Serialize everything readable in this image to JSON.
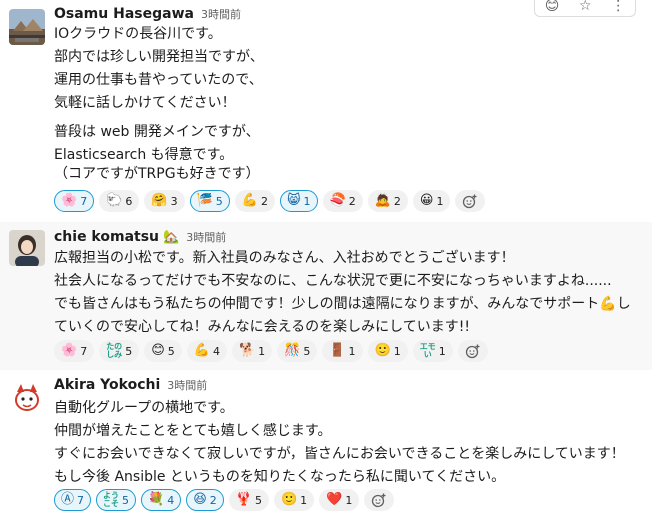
{
  "messages": [
    {
      "name": "Osamu Hasegawa",
      "status_emoji": "",
      "time": "3時間前",
      "lines": [
        "IOクラウドの長谷川です。",
        "部内では珍しい開発担当ですが、",
        "運用の仕事も昔やっていたので、",
        "気軽に話しかけてください！",
        "",
        "普段は web 開発メインですが、",
        "Elasticsearch も得意です。",
        "（コアですがTRPGも好きです）"
      ],
      "reactions": [
        {
          "icon": "cherry-blossom-icon",
          "glyph": "🌸",
          "count": "7",
          "mine": true
        },
        {
          "icon": "sheep-icon",
          "glyph": "🐑",
          "count": "6",
          "mine": false
        },
        {
          "icon": "hugging-face-icon",
          "glyph": "🤗",
          "count": "3",
          "mine": false
        },
        {
          "icon": "party-banner-icon",
          "glyph": "🎏",
          "count": "5",
          "mine": true
        },
        {
          "icon": "flexed-biceps-icon",
          "glyph": "💪",
          "count": "2",
          "mine": false
        },
        {
          "icon": "cat-face-icon",
          "glyph": "😸",
          "count": "1",
          "mine": true
        },
        {
          "icon": "sushi-icon",
          "glyph": "🍣",
          "count": "2",
          "mine": false
        },
        {
          "icon": "bow-person-icon",
          "glyph": "🙇",
          "count": "2",
          "mine": false
        },
        {
          "icon": "grinning-face-icon",
          "glyph": "😀",
          "count": "1",
          "mine": false
        }
      ],
      "hover_actions": [
        "😊",
        "☆",
        "⋮"
      ]
    },
    {
      "name": "chie komatsu",
      "status_emoji": "🏡",
      "time": "3時間前",
      "lines": [
        "広報担当の小松です。新入社員のみなさん、入社おめでとうございます！",
        "社会人になるってだけでも不安なのに、こんな状況で更に不安になっちゃいますよね......",
        "でも皆さんはもう私たちの仲間です！少しの間は遠隔になりますが、みんなでサポート💪し",
        "ていくので安心してね！みんなに会えるのを楽しみにしています!!"
      ],
      "reactions": [
        {
          "icon": "cherry-blossom-icon",
          "glyph": "🌸",
          "count": "7",
          "mine": false
        },
        {
          "icon": "tanoshimi-text-icon",
          "text": "たの しみ",
          "count": "5",
          "mine": false
        },
        {
          "icon": "smiling-face-icon",
          "glyph": "😊",
          "count": "5",
          "mine": false
        },
        {
          "icon": "flexed-biceps-icon",
          "glyph": "💪",
          "count": "4",
          "mine": false
        },
        {
          "icon": "dog-icon",
          "glyph": "🐕",
          "count": "1",
          "mine": false
        },
        {
          "icon": "kangei-text-icon",
          "glyph": "🎊",
          "count": "5",
          "mine": false
        },
        {
          "icon": "person-door-icon",
          "glyph": "🚪",
          "count": "1",
          "mine": false
        },
        {
          "icon": "slight-smile-icon",
          "glyph": "🙂",
          "count": "1",
          "mine": false
        },
        {
          "icon": "emoi-text-icon",
          "text": "エモ い",
          "count": "1",
          "mine": false
        }
      ]
    },
    {
      "name": "Akira Yokochi",
      "status_emoji": "",
      "time": "3時間前",
      "lines": [
        "自動化グループの横地です。",
        "仲間が増えたことをとても嬉しく感じます。",
        "すぐにお会いできなくて寂しいですが，皆さんにお会いできることを楽しみにしています！",
        "もし今後 Ansible というものを知りたくなったら私に聞いてください。"
      ],
      "reactions": [
        {
          "icon": "ansible-icon",
          "glyph": "Ⓐ",
          "count": "7",
          "mine": true
        },
        {
          "icon": "youkoso-text-icon",
          "text": "よう こそ",
          "count": "5",
          "mine": true
        },
        {
          "icon": "flower-icon",
          "glyph": "💐",
          "count": "4",
          "mine": true
        },
        {
          "icon": "grin-face-icon",
          "glyph": "😆",
          "count": "2",
          "mine": true
        },
        {
          "icon": "red-figure-icon",
          "glyph": "🦞",
          "count": "5",
          "mine": false
        },
        {
          "icon": "slight-smile-icon",
          "glyph": "🙂",
          "count": "1",
          "mine": false
        },
        {
          "icon": "heart-icon",
          "glyph": "❤️",
          "count": "1",
          "mine": false
        }
      ]
    }
  ]
}
